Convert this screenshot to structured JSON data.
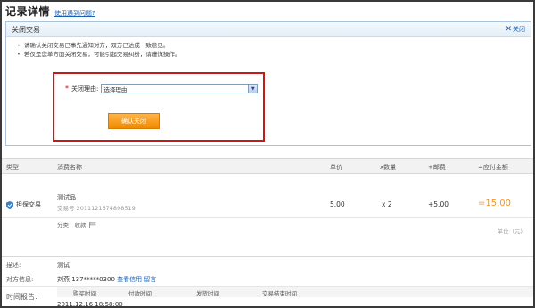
{
  "header": {
    "title": "记录详情",
    "help_link": "使用遇到问题?"
  },
  "close_panel": {
    "title": "关闭交易",
    "close_label": "关闭",
    "close_icon": "close-x-icon",
    "notices": [
      "请确认关闭交易已事先通知对方，双方已达成一致意见。",
      "若仅是您单方面关闭交易，可能引起交易纠纷，请谨慎操作。"
    ],
    "reason_label": "关闭理由:",
    "reason_selected": "选择理由",
    "confirm_button": "确认关闭"
  },
  "table": {
    "headers": {
      "type": "类型",
      "item_name": "消费名称",
      "price": "单价",
      "qty": "x数量",
      "shipping": "+邮费",
      "total": "=应付金额"
    },
    "row": {
      "type": "担保交易",
      "name": "测试品",
      "trade_no": "交易号 2011121674898519",
      "price": "5.00",
      "qty": "x 2",
      "shipping": "+5.00",
      "total": "=15.00",
      "category": "分类：收款"
    },
    "unit_note": "单位（元）"
  },
  "details": {
    "desc_label": "描述:",
    "desc_value": "测试",
    "party_label": "对方信息:",
    "party_value": "刘燕 137*****0300",
    "party_link_credit": "查看信用",
    "party_link_msg": "留言",
    "time_label": "时间报告:",
    "time_headers": {
      "buy": "购买时间",
      "pay": "付款时间",
      "ship": "发货时间",
      "end": "交易结束时间"
    },
    "buy_time": "2011.12.16 18:58:00"
  },
  "colors": {
    "accent_orange": "#f7931e",
    "highlight_red": "#c41a1a",
    "link_blue": "#1a5fb4"
  }
}
